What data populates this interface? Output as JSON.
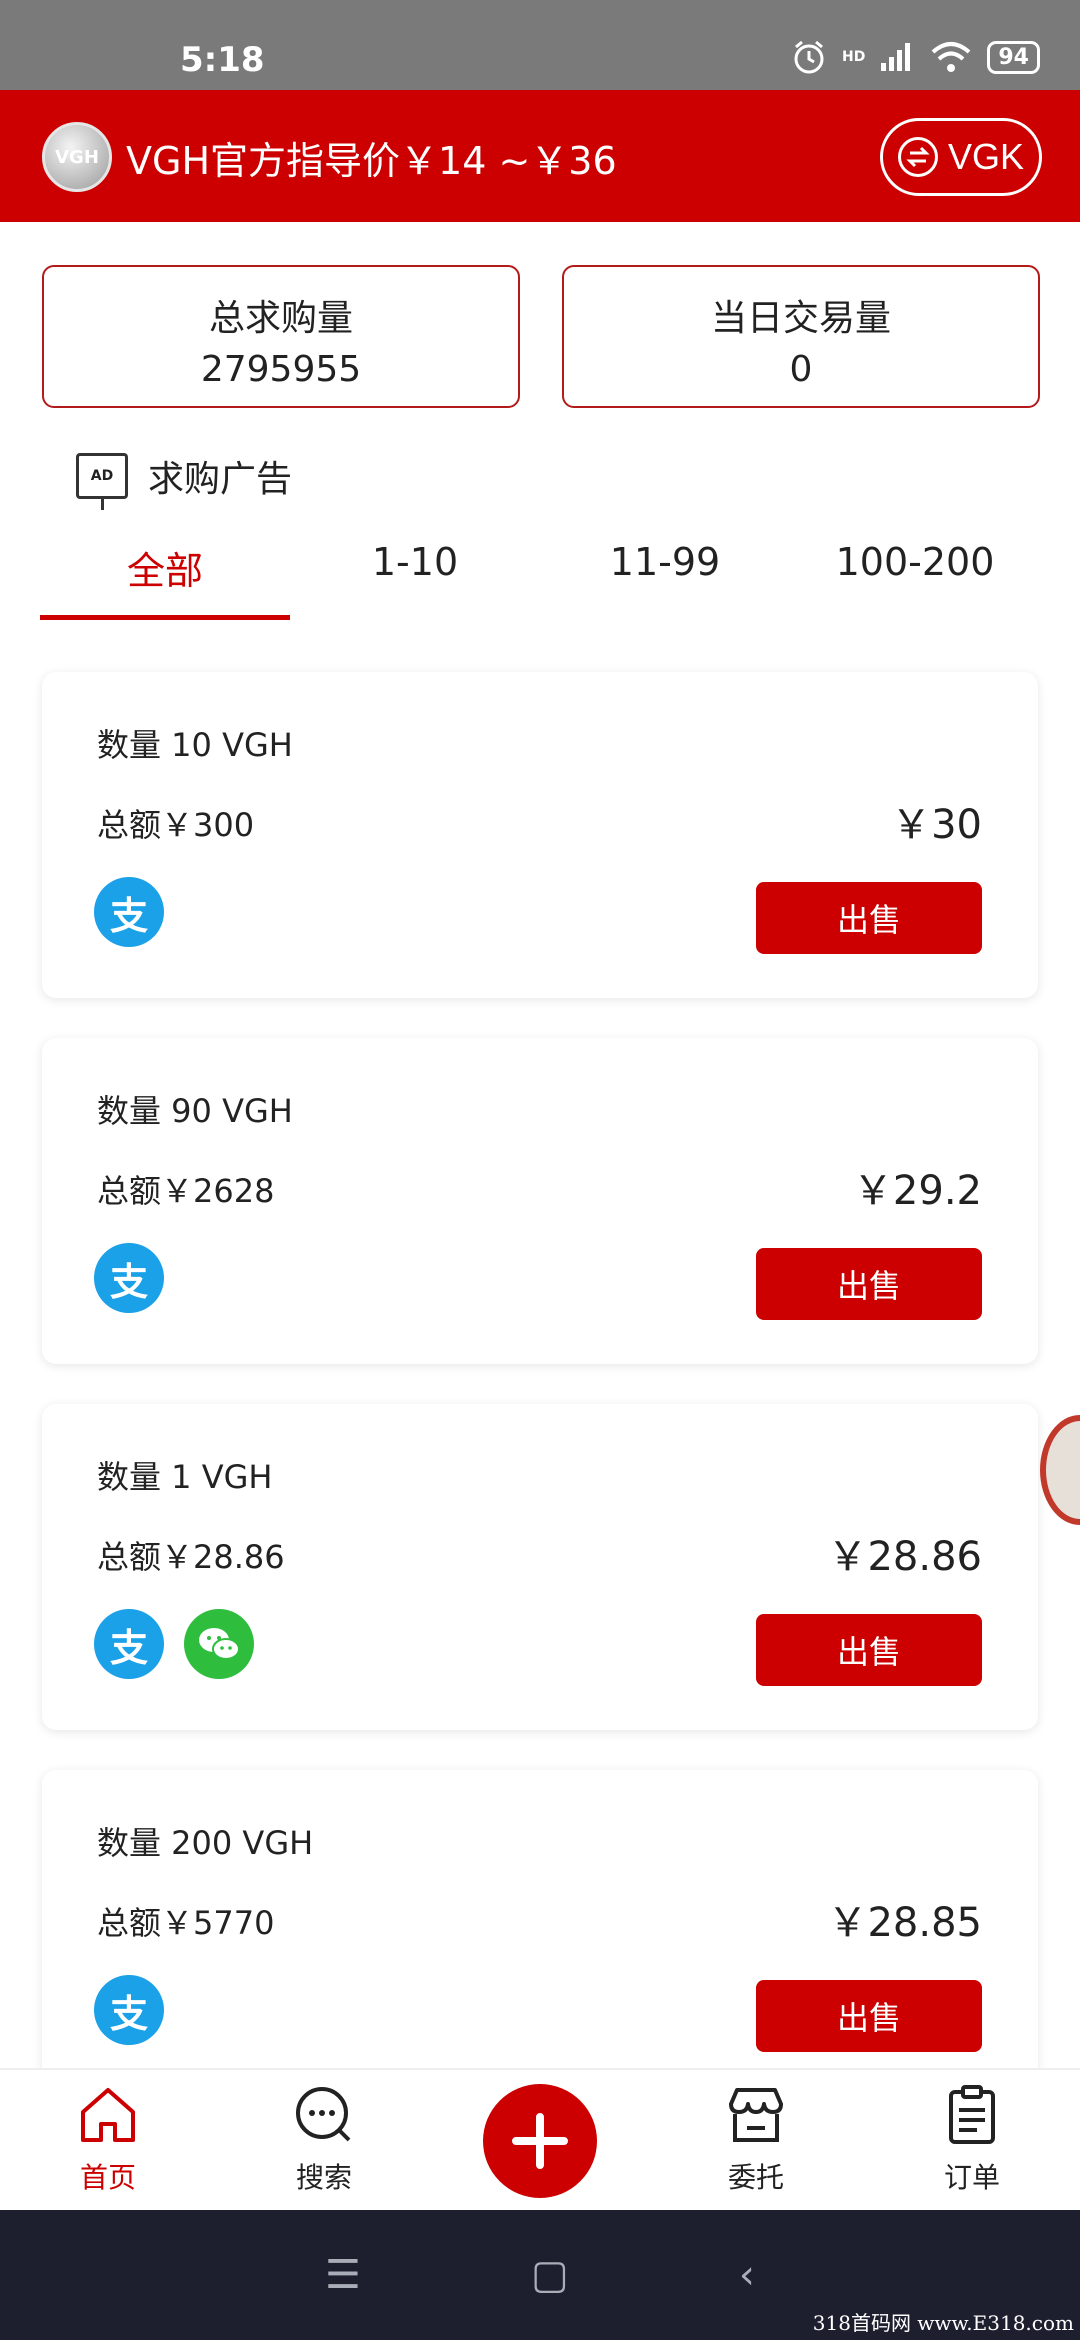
{
  "status_bar": {
    "time": "5:18",
    "battery": "94",
    "network": "HD"
  },
  "header": {
    "logo_text": "VGH",
    "title": "VGH官方指导价￥14 ~￥36",
    "switch_label": "VGK"
  },
  "stats": [
    {
      "label": "总求购量",
      "value": "2795955"
    },
    {
      "label": "当日交易量",
      "value": "0"
    }
  ],
  "ad_section": {
    "icon_text": "AD",
    "title": "求购广告"
  },
  "tabs": [
    {
      "label": "全部",
      "active": true
    },
    {
      "label": "1-10",
      "active": false
    },
    {
      "label": "11-99",
      "active": false
    },
    {
      "label": "100-200",
      "active": false
    }
  ],
  "listings": [
    {
      "quantity": "数量 10 VGH",
      "total": "总额￥300",
      "price": "￥30",
      "payments": [
        "alipay"
      ],
      "action": "出售"
    },
    {
      "quantity": "数量 90 VGH",
      "total": "总额￥2628",
      "price": "￥29.2",
      "payments": [
        "alipay"
      ],
      "action": "出售"
    },
    {
      "quantity": "数量 1 VGH",
      "total": "总额￥28.86",
      "price": "￥28.86",
      "payments": [
        "alipay",
        "wechat"
      ],
      "action": "出售"
    },
    {
      "quantity": "数量 200 VGH",
      "total": "总额￥5770",
      "price": "￥28.85",
      "payments": [
        "alipay"
      ],
      "action": "出售"
    }
  ],
  "payment_icons": {
    "alipay": "支",
    "wechat_icon": "wechat-icon"
  },
  "bottom_nav": [
    {
      "label": "首页",
      "icon": "home-icon",
      "active": true
    },
    {
      "label": "搜索",
      "icon": "search-icon",
      "active": false
    },
    {
      "label": "",
      "icon": "plus-icon",
      "active": false
    },
    {
      "label": "委托",
      "icon": "store-icon",
      "active": false
    },
    {
      "label": "订单",
      "icon": "clipboard-icon",
      "active": false
    }
  ],
  "system_nav": {
    "menu": "☰",
    "home": "▢",
    "back": "‹"
  },
  "watermark": "318首码网 www.E318.com",
  "colors": {
    "brand": "#cc0000",
    "alipay": "#1aa1e8",
    "wechat": "#2fbd3e",
    "nav_bar": "#1d1f2e"
  }
}
